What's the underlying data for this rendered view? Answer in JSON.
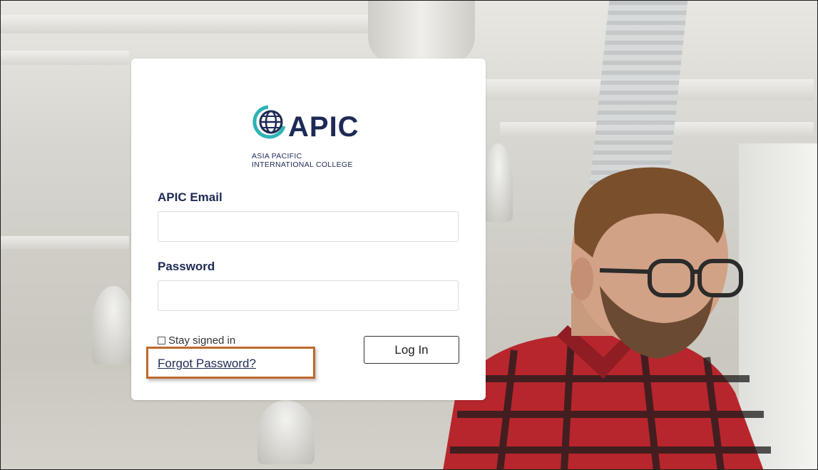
{
  "logo": {
    "wordmark": "APIC",
    "subtitle_line1": "ASIA PACIFIC",
    "subtitle_line2": "INTERNATIONAL COLLEGE",
    "icon": "globe-icon"
  },
  "form": {
    "email_label": "APIC Email",
    "email_value": "",
    "password_label": "Password",
    "password_value": "",
    "stay_signed_in_label": "Stay signed in",
    "stay_signed_in_checked": false,
    "forgot_password_label": "Forgot Password?",
    "login_button_label": "Log In"
  },
  "colors": {
    "brand_navy": "#1e2a55",
    "brand_teal": "#2fb3b5",
    "highlight_border": "#c0692c"
  }
}
